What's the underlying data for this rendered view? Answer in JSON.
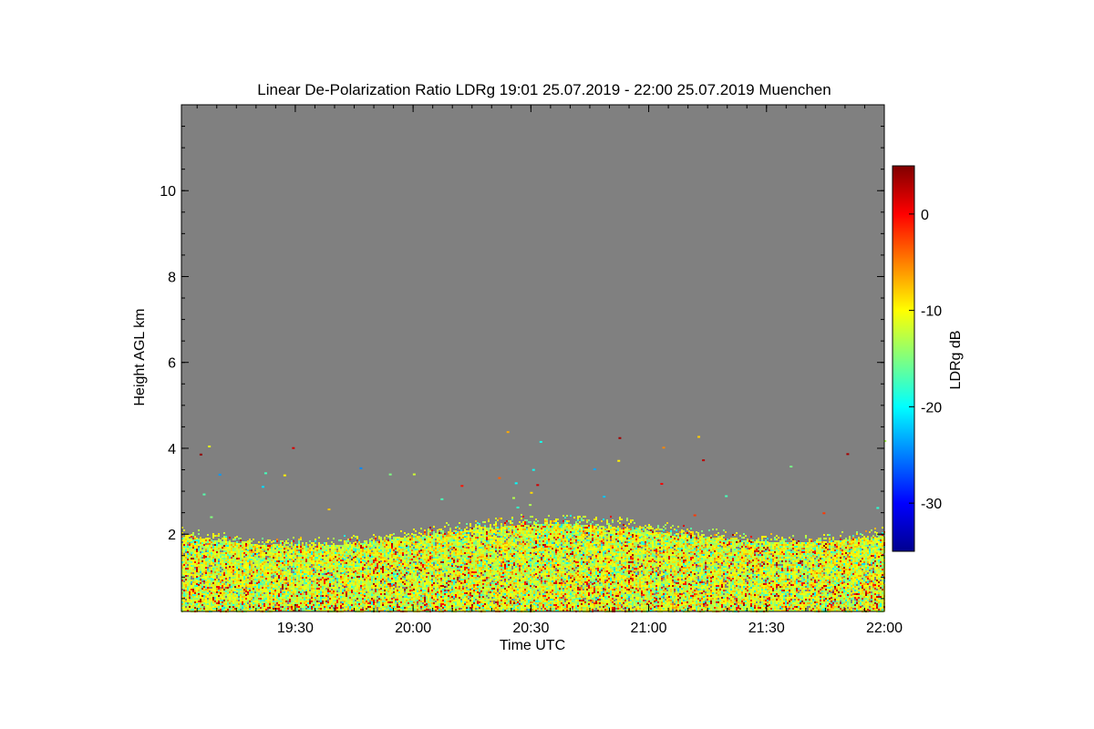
{
  "chart_data": {
    "type": "heatmap",
    "title": "Linear De-Polarization Ratio LDRg   19:01 25.07.2019 - 22:00 25.07.2019 Muenchen",
    "xlabel": "Time UTC",
    "ylabel": "Height AGL km",
    "colorbar_label": "LDRg dB",
    "xlim": [
      "19:01",
      "22:00"
    ],
    "ylim": [
      0.2,
      12.0
    ],
    "x_ticks": [
      "19:30",
      "20:00",
      "20:30",
      "21:00",
      "21:30",
      "22:00"
    ],
    "y_ticks": [
      2,
      4,
      6,
      8,
      10
    ],
    "colorbar_range": [
      -35,
      5
    ],
    "colorbar_ticks": [
      0,
      -10,
      -20,
      -30
    ],
    "colormap": "jet",
    "background_color": "#808080",
    "signal_layer_top_km": 2.2,
    "typical_ldr_db": [
      -15,
      -8
    ],
    "grid": false
  }
}
